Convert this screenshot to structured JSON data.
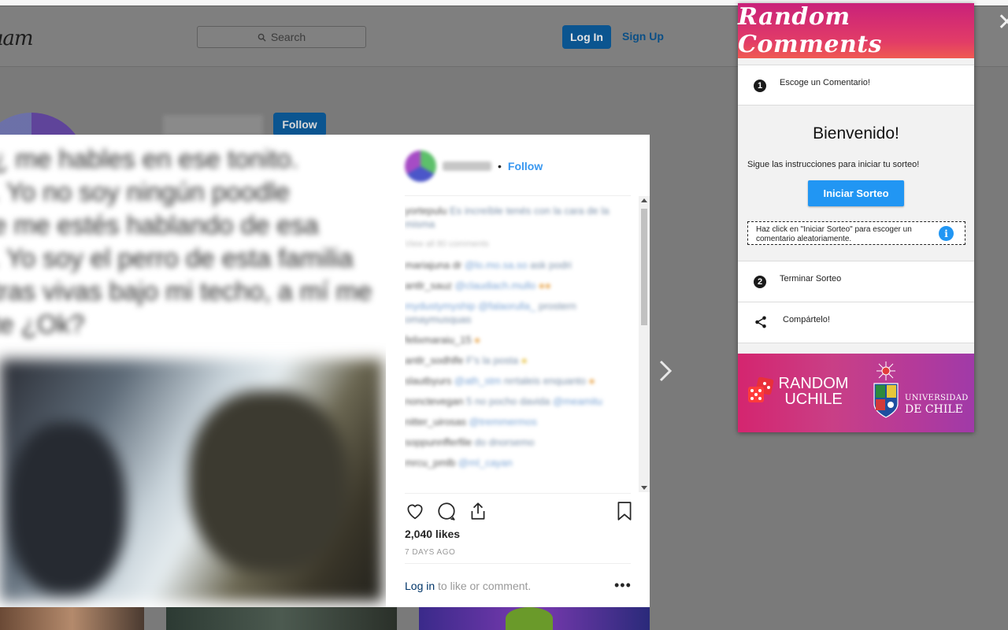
{
  "background_page": {
    "logo": "ıam",
    "search": {
      "placeholder": "Search"
    },
    "login_label": "Log In",
    "signup_label": "Sign Up",
    "profile_follow_label": "Follow"
  },
  "post": {
    "author_follow_label": "Follow",
    "author_separator": "•",
    "likes": "2,040 likes",
    "time_ago": "7 DAYS AGO",
    "login_link": "Log in",
    "login_suffix": " to like or comment.",
    "more_icon": "more-horizontal-icon"
  },
  "extension": {
    "title": "Random Comments",
    "steps": [
      {
        "number": "1",
        "label": "Escoge un Comentario!"
      },
      {
        "number": "2",
        "label": "Terminar Sorteo"
      }
    ],
    "welcome": {
      "title": "Bienvenido!",
      "subtitle": "Sigue las instrucciones para iniciar tu sorteo!",
      "start_button": "Iniciar Sorteo",
      "hint": "Haz click en \"Iniciar Sorteo\" para escoger un comentario aleatoriamente."
    },
    "share_label": "Compártelo!",
    "banner": {
      "brand_line1": "RANDOM",
      "brand_line2": "UCHILE",
      "university_line1": "UNIVERSIDAD",
      "university_line2": "DE CHILE"
    },
    "colors": {
      "accent_blue": "#2196f3",
      "header_pink": "#d82a70"
    }
  }
}
